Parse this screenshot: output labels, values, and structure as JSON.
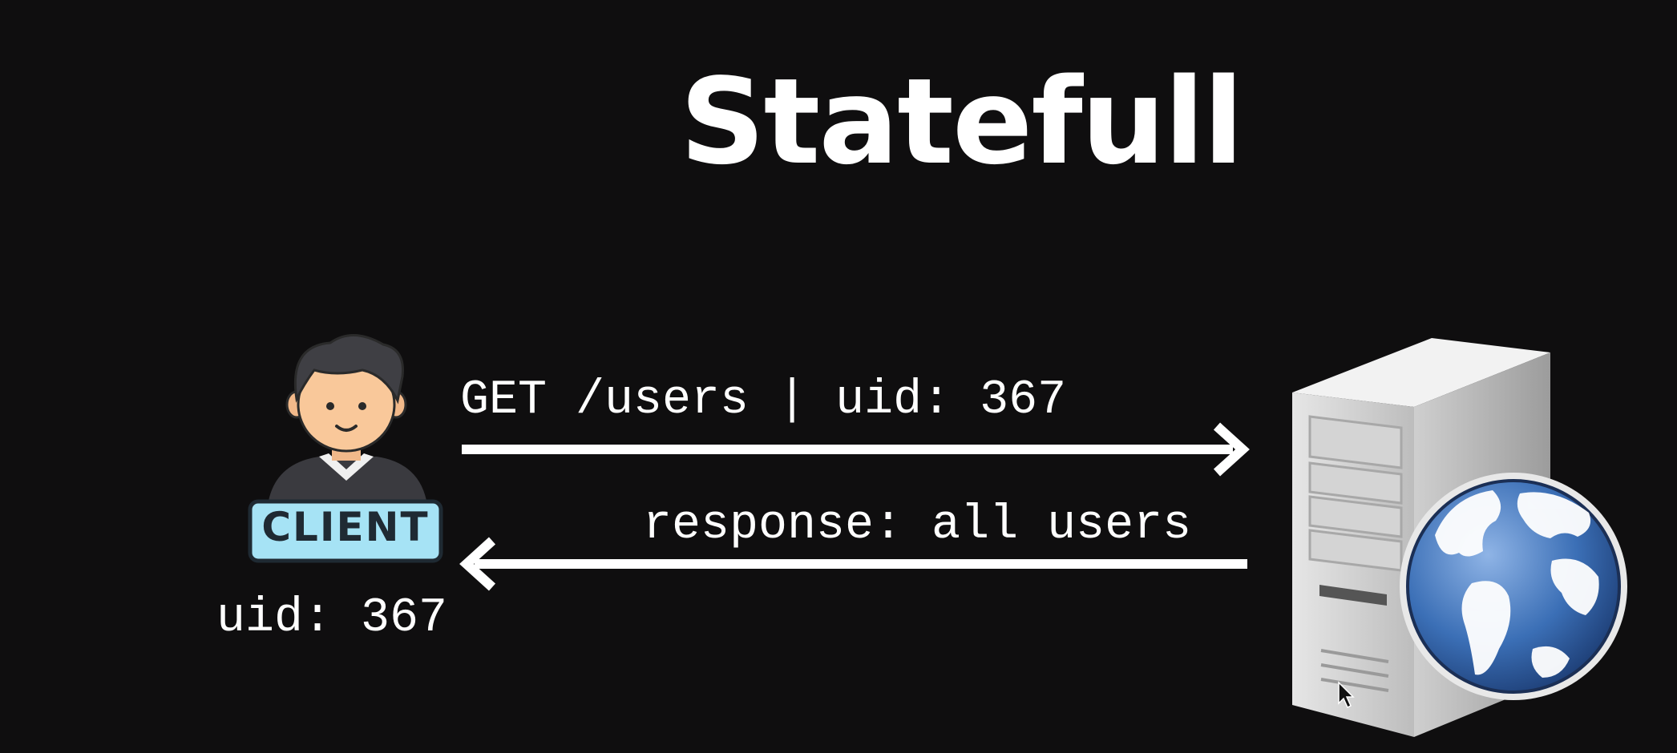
{
  "title": "Statefull",
  "client": {
    "badge_label": "CLIENT",
    "uid_label": "uid: 367"
  },
  "request": {
    "label": "GET /users | uid: 367"
  },
  "response": {
    "label": "response: all users"
  },
  "colors": {
    "background": "#0f0e0f",
    "text": "#ffffff",
    "badge": "#a6e3f5",
    "globe_ocean": "#3b6fb6"
  },
  "icons": {
    "client": "client-person-icon",
    "server": "server-globe-icon",
    "cursor": "mouse-pointer-icon"
  }
}
